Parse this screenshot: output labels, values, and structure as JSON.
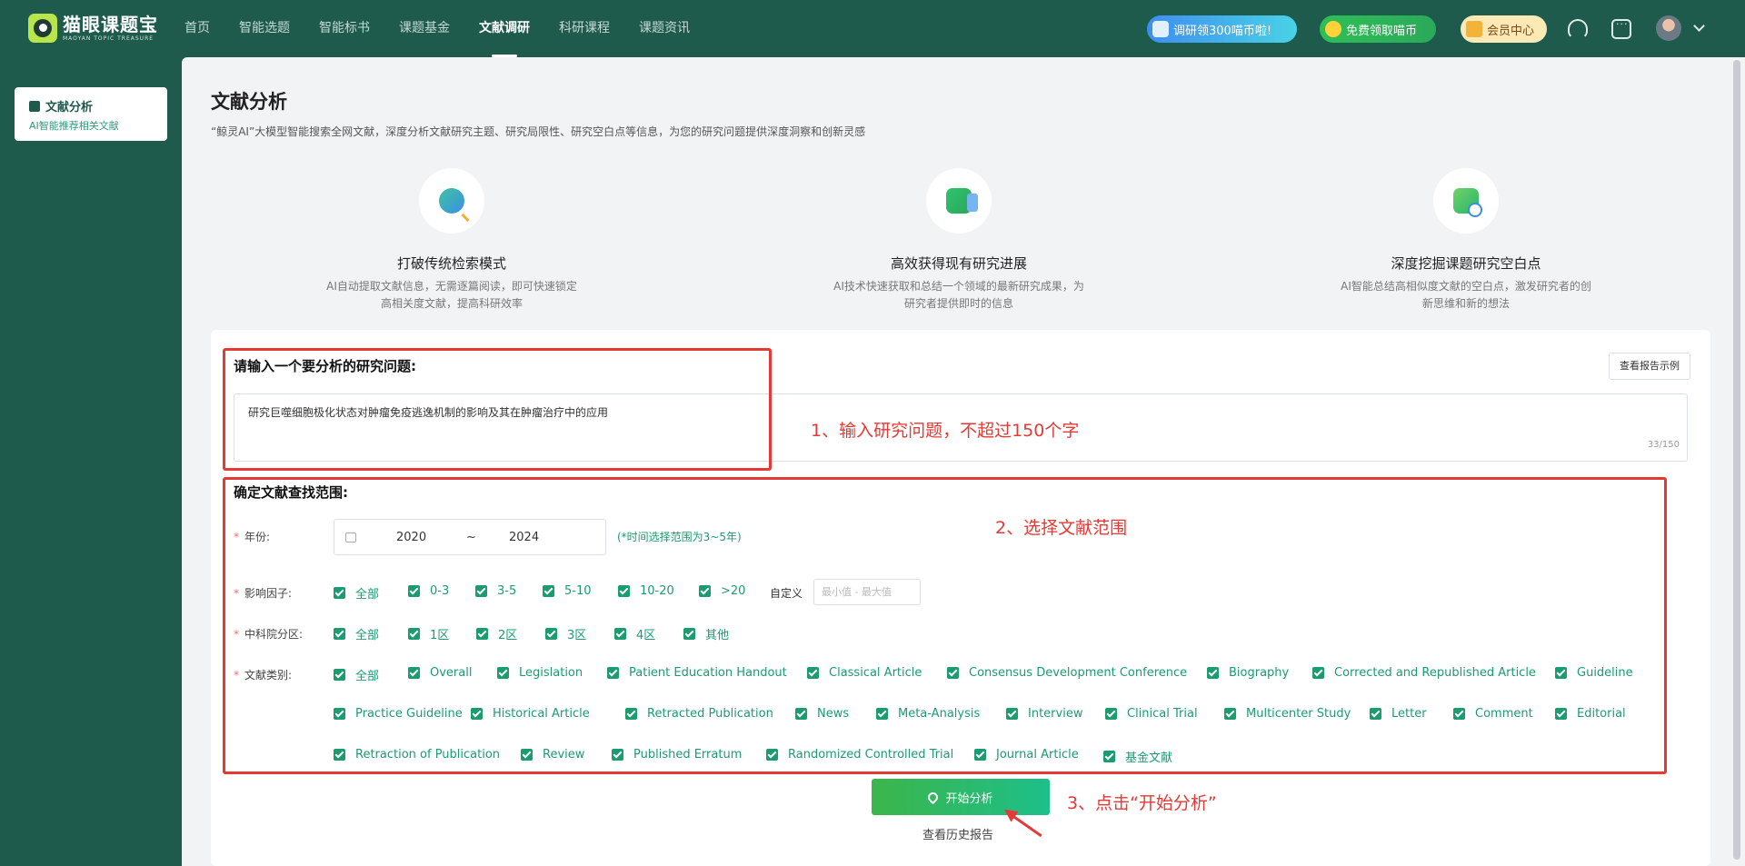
{
  "app": {
    "logo_cn": "猫眼课题宝",
    "logo_en": "MAOYAN TOPIC TREASURE"
  },
  "nav": {
    "items": [
      "首页",
      "智能选题",
      "智能标书",
      "课题基金",
      "文献调研",
      "科研课程",
      "课题资讯"
    ],
    "active": "文献调研"
  },
  "header": {
    "research_promo": "调研领300喵币啦!",
    "free_coins": "免费领取喵币",
    "vip_center": "会员中心"
  },
  "sidebar": {
    "title": "文献分析",
    "subtitle": "AI智能推荐相关文献"
  },
  "page": {
    "title": "文献分析",
    "description": "“鲸灵AI”大模型智能搜索全网文献，深度分析文献研究主题、研究局限性、研究空白点等信息，为您的研究问题提供深度洞察和创新灵感"
  },
  "features": [
    {
      "icon": "search-ai-icon",
      "title": "打破传统检索模式",
      "desc": "AI自动提取文献信息，无需逐篇阅读，即可快速锁定高相关度文献，提高科研效率"
    },
    {
      "icon": "progress-icon",
      "title": "高效获得现有研究进展",
      "desc": "AI技术快速获取和总结一个领域的最新研究成果，为研究者提供即时的信息"
    },
    {
      "icon": "gap-icon",
      "title": "深度挖掘课题研究空白点",
      "desc": "AI智能总结高相似度文献的空白点，激发研究者的创新思维和新的想法"
    }
  ],
  "form": {
    "question_label": "请输入一个要分析的研究问题:",
    "report_example": "查看报告示例",
    "question_value": "研究巨噬细胞极化状态对肿瘤免疫逃逸机制的影响及其在肿瘤治疗中的应用",
    "word_count": "33/150",
    "scope_label": "确定文献查找范围:",
    "year_label": "年份:",
    "year_start": "2020",
    "year_sep": "~",
    "year_end": "2024",
    "year_hint": "(*时间选择范围为3~5年)",
    "impact_label": "影响因子:",
    "impact_options": [
      "全部",
      "0-3",
      "3-5",
      "5-10",
      "10-20",
      ">20"
    ],
    "custom_label": "自定义",
    "custom_placeholder": "最小值 -   最大值",
    "cas_label": "中科院分区:",
    "cas_options": [
      "全部",
      "1区",
      "2区",
      "3区",
      "4区",
      "其他"
    ],
    "type_label": "文献类别:",
    "type_options": [
      "全部",
      "Overall",
      "Legislation",
      "Patient Education Handout",
      "Classical Article",
      "Consensus Development Conference",
      "Biography",
      "Corrected and Republished Article",
      "Guideline",
      "Practice Guideline",
      "Historical Article",
      "Retracted Publication",
      "News",
      "Meta-Analysis",
      "Interview",
      "Clinical Trial",
      "Multicenter Study",
      "Letter",
      "Comment",
      "Editorial",
      "Retraction of Publication",
      "Review",
      "Published Erratum",
      "Randomized Controlled Trial",
      "Journal Article",
      "基金文献"
    ],
    "start_button": "开始分析",
    "history_link": "查看历史报告"
  },
  "annotations": {
    "step1": "1、输入研究问题，不超过150个字",
    "step2": "2、选择文献范围",
    "step3": "3、点击“开始分析”"
  },
  "colors": {
    "brand_dark": "#1f5b4d",
    "accent_green": "#1a9c6e",
    "annotation_red": "#e53935"
  }
}
